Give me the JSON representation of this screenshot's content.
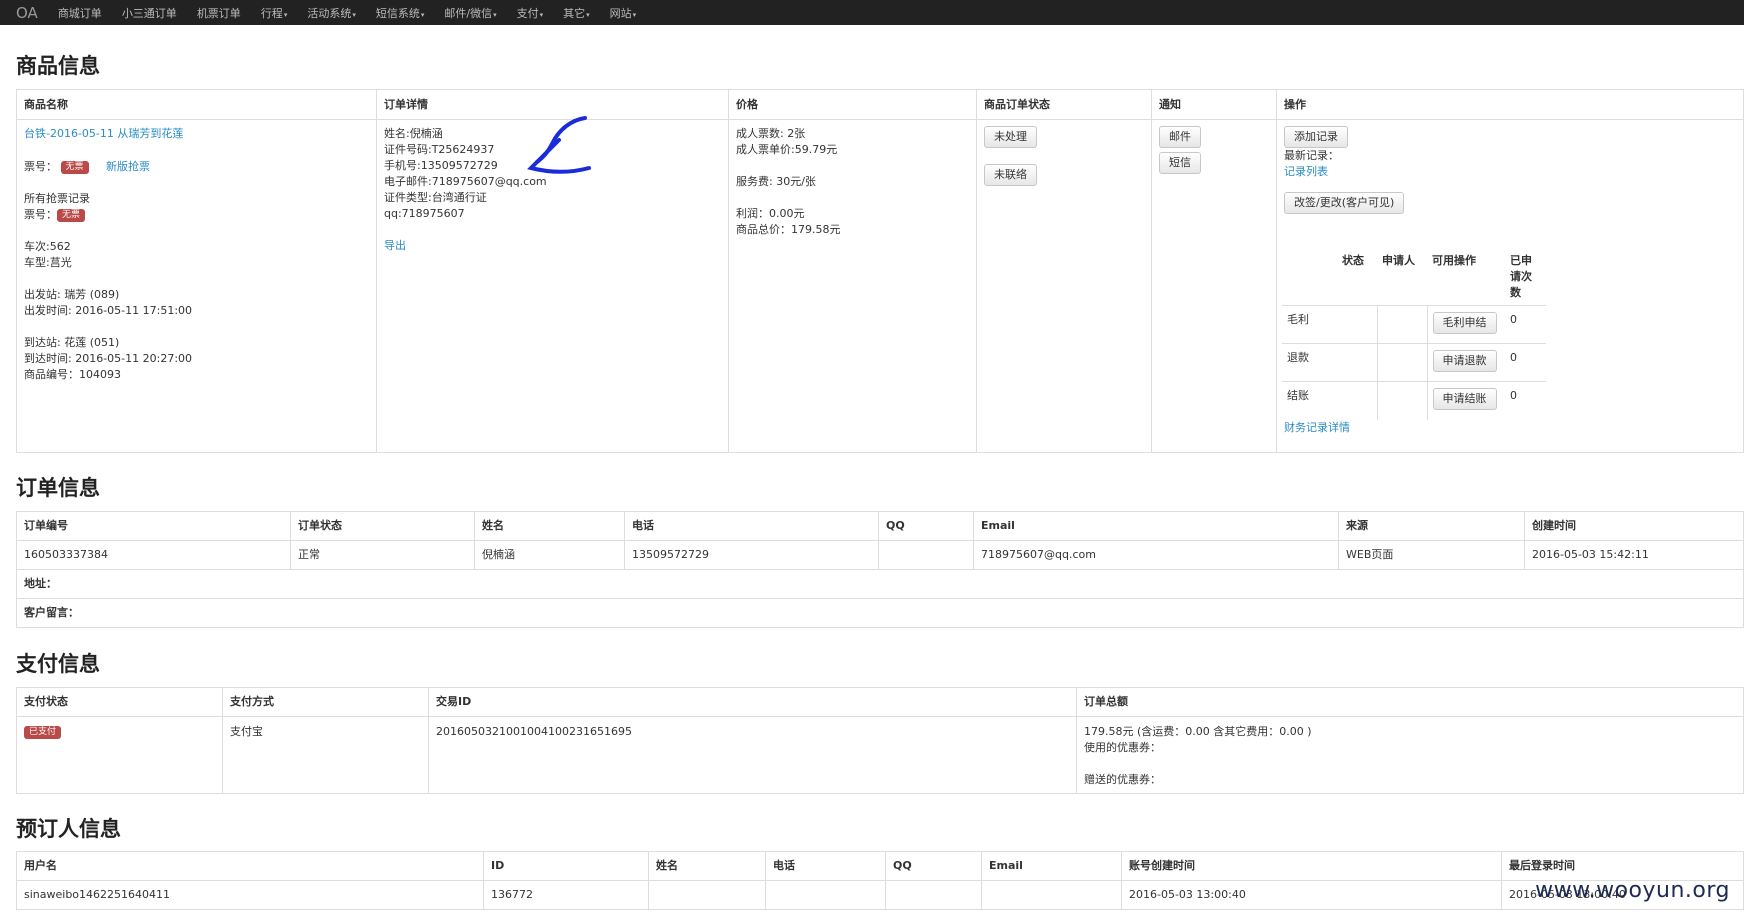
{
  "nav": {
    "brand": "OA",
    "items": [
      "商城订单",
      "小三通订单",
      "机票订单",
      "行程",
      "活动系统",
      "短信系统",
      "邮件/微信",
      "支付",
      "其它",
      "网站"
    ],
    "dropdown_items": [
      false,
      false,
      false,
      true,
      true,
      true,
      true,
      true,
      true,
      true
    ]
  },
  "product": {
    "title": "商品信息",
    "headers": [
      "商品名称",
      "订单详情",
      "价格",
      "商品订单状态",
      "通知",
      "操作"
    ],
    "name_link": "台铁-2016-05-11 从瑞芳到花莲",
    "ticket_label": "票号：",
    "ticket_badge": "无票",
    "new_grab_link": "新版抢票",
    "all_grab_records": "所有抢票记录",
    "ticket_label2": "票号：",
    "ticket_badge2": "无票",
    "train_no": "车次:562",
    "train_type": "车型:莒光",
    "depart_station": "出发站: 瑞芳 (089)",
    "depart_time": "出发时间: 2016-05-11 17:51:00",
    "arrive_station": "到达站: 花莲 (051)",
    "arrive_time": "到达时间: 2016-05-11 20:27:00",
    "product_no": "商品编号：104093",
    "detail_name": "姓名:倪楠涵",
    "detail_id": "证件号码:T25624937",
    "detail_phone": "手机号:13509572729",
    "detail_email": "电子邮件:718975607@qq.com",
    "detail_id_type": "证件类型:台湾通行证",
    "detail_qq": "qq:718975607",
    "export_link": "导出",
    "price_adult_count": "成人票数: 2张",
    "price_adult_unit": "成人票单价:59.79元",
    "price_service": "服务费: 30元/张",
    "price_profit": "利润：0.00元",
    "price_total": "商品总价：179.58元",
    "status_btn1": "未处理",
    "status_btn2": "未联络",
    "notify_email": "邮件",
    "notify_sms": "短信",
    "op_add_record": "添加记录",
    "op_latest_record": "最新记录：",
    "op_record_list": "记录列表",
    "op_change": "改签/更改(客户可见)",
    "stats_headers": [
      "",
      "状态",
      "申请人",
      "可用操作",
      "已申请次数"
    ],
    "stats_rows": [
      {
        "label": "毛利",
        "status": "",
        "applicant": "",
        "action": "毛利申结",
        "count": "0"
      },
      {
        "label": "退款",
        "status": "",
        "applicant": "",
        "action": "申请退款",
        "count": "0"
      },
      {
        "label": "结账",
        "status": "",
        "applicant": "",
        "action": "申请结账",
        "count": "0"
      }
    ],
    "finance_link": "财务记录详情"
  },
  "order": {
    "title": "订单信息",
    "headers": [
      "订单编号",
      "订单状态",
      "姓名",
      "电话",
      "QQ",
      "Email",
      "来源",
      "创建时间"
    ],
    "row": [
      "160503337384",
      "正常",
      "倪楠涵",
      "13509572729",
      "",
      "718975607@qq.com",
      "WEB页面",
      "2016-05-03 15:42:11"
    ],
    "address_label": "地址：",
    "message_label": "客户留言："
  },
  "payment": {
    "title": "支付信息",
    "headers": [
      "支付状态",
      "支付方式",
      "交易ID",
      "订单总额"
    ],
    "status_badge": "已支付",
    "method": "支付宝",
    "trade_id": "2016050321001004100231651695",
    "total_line": "179.58元 (含运费：0.00 含其它费用：0.00 )",
    "coupon_used": "使用的优惠券：",
    "coupon_gift": "赠送的优惠券："
  },
  "booker": {
    "title": "预订人信息",
    "headers": [
      "用户名",
      "ID",
      "姓名",
      "电话",
      "QQ",
      "Email",
      "账号创建时间",
      "最后登录时间"
    ],
    "row": [
      "sinaweibo1462251640411",
      "136772",
      "",
      "",
      "",
      "",
      "2016-05-03 13:00:40",
      "2016-05-03 13:00:40"
    ]
  },
  "watermark": "www.wooyun.org",
  "colors": {
    "navbar": "#222222",
    "link": "#2a8cc4",
    "badge": "#b94a48",
    "annotation": "#1a2bd8"
  }
}
